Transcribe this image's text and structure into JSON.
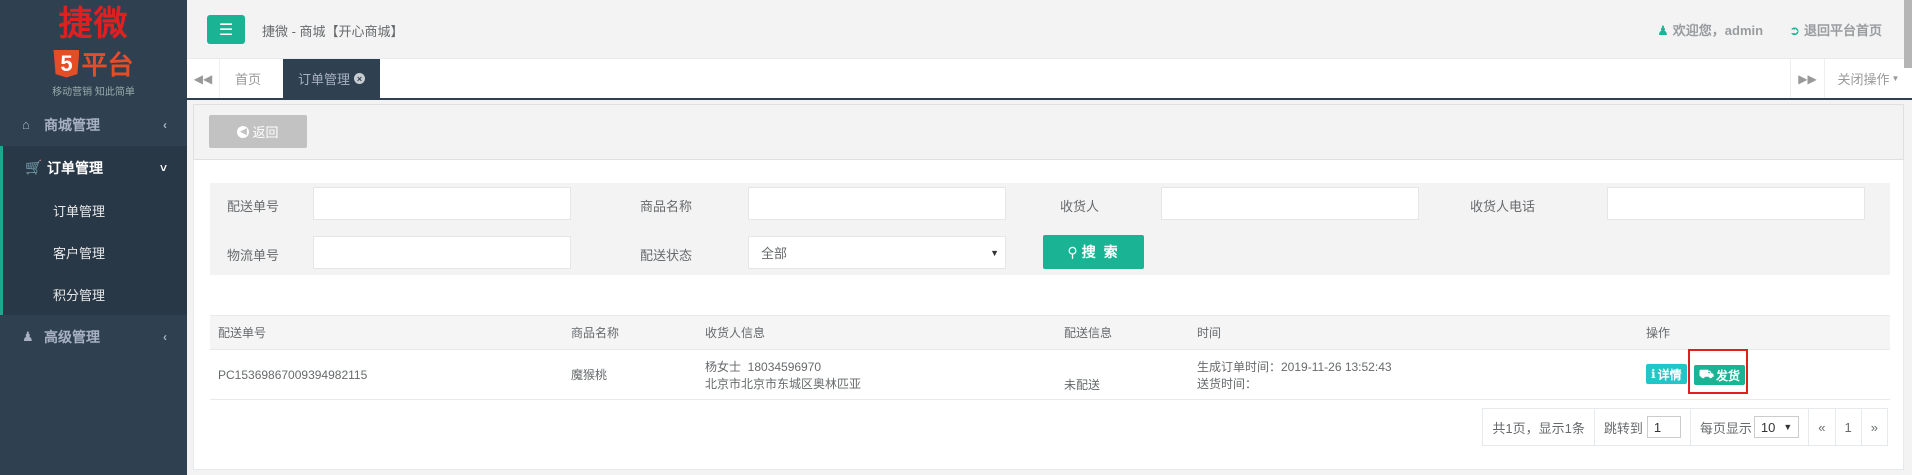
{
  "app": {
    "logo_top": "捷微",
    "logo_mark": "5",
    "logo_name": "平台",
    "logo_sub": "移动营销 知此简单",
    "title": "捷微 - 商城【开心商城】",
    "welcome": "欢迎您，admin",
    "back_home": "退回平台首页"
  },
  "sidebar": {
    "mall": "商城管理",
    "order_group": "订单管理",
    "subitems": [
      "订单管理",
      "客户管理",
      "积分管理"
    ],
    "advanced": "高级管理"
  },
  "tabs": {
    "home": "首页",
    "order": "订单管理",
    "close_ops": "关闭操作"
  },
  "back_button": "返回",
  "search": {
    "labels": {
      "delivery_no": "配送单号",
      "product_name": "商品名称",
      "receiver": "收货人",
      "receiver_phone": "收货人电话",
      "logistics_no": "物流单号",
      "delivery_status": "配送状态"
    },
    "delivery_status_value": "全部",
    "search_button": "搜 索"
  },
  "table": {
    "headers": [
      "配送单号",
      "商品名称",
      "收货人信息",
      "配送信息",
      "时间",
      "操作"
    ],
    "rows": [
      {
        "delivery_no": "PC15369867009394982115",
        "product": "魔猴桃",
        "receiver_name_phone": "杨女士  18034596970",
        "receiver_address": "北京市北京市东城区奥林匹亚",
        "delivery_info": "未配送",
        "time_created": "生成订单时间：2019-11-26 13:52:43",
        "time_shipped": "送货时间：",
        "detail_button": "详情",
        "ship_button": "发货"
      }
    ]
  },
  "pager": {
    "summary": "共1页，显示1条",
    "jump_label": "跳转到",
    "jump_value": "1",
    "per_page_label": "每页显示",
    "per_page_value": "10",
    "prev": "«",
    "current": "1",
    "next": "»"
  },
  "colors": {
    "sidebar": "#2f4050",
    "primary": "#1ab394",
    "info": "#23c6c8",
    "highlight": "#e02020"
  }
}
